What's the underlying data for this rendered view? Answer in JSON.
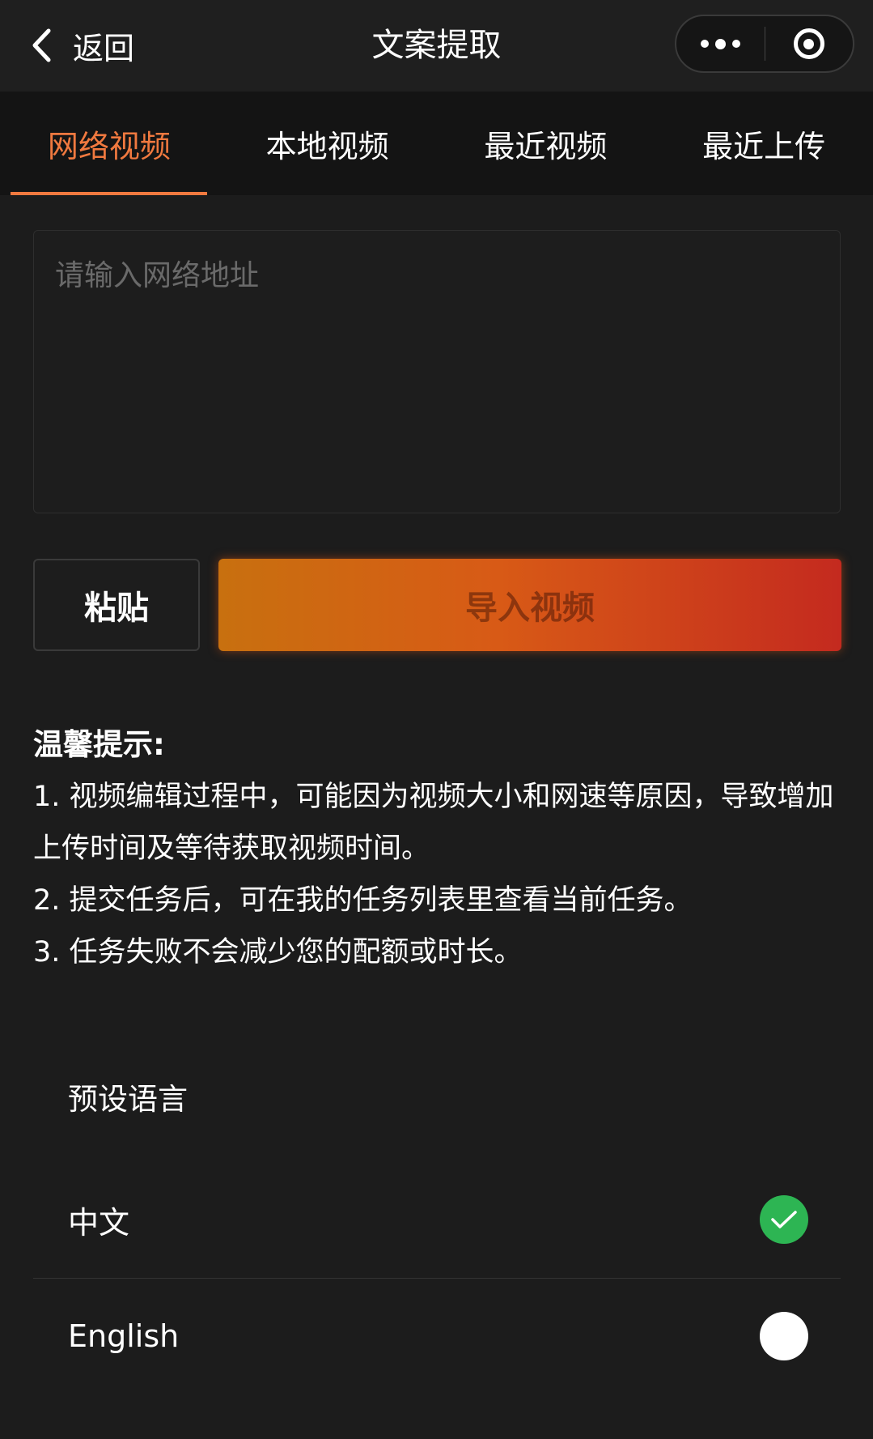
{
  "header": {
    "back_label": "返回",
    "title": "文案提取"
  },
  "tabs": [
    {
      "label": "网络视频",
      "active": true
    },
    {
      "label": "本地视频",
      "active": false
    },
    {
      "label": "最近视频",
      "active": false
    },
    {
      "label": "最近上传",
      "active": false
    }
  ],
  "url_input": {
    "placeholder": "请输入网络地址",
    "value": ""
  },
  "buttons": {
    "paste": "粘贴",
    "import": "导入视频"
  },
  "tips": {
    "title": "温馨提示:",
    "items": [
      "1. 视频编辑过程中，可能因为视频大小和网速等原因，导致增加上传时间及等待获取视频时间。",
      "2. 提交任务后，可在我的任务列表里查看当前任务。",
      "3. 任务失败不会减少您的配额或时长。"
    ]
  },
  "language": {
    "title": "预设语言",
    "options": [
      {
        "label": "中文",
        "selected": true
      },
      {
        "label": "English",
        "selected": false
      }
    ]
  },
  "colors": {
    "accent": "#f0793f",
    "check_green": "#2db553",
    "background": "#1c1c1c"
  }
}
